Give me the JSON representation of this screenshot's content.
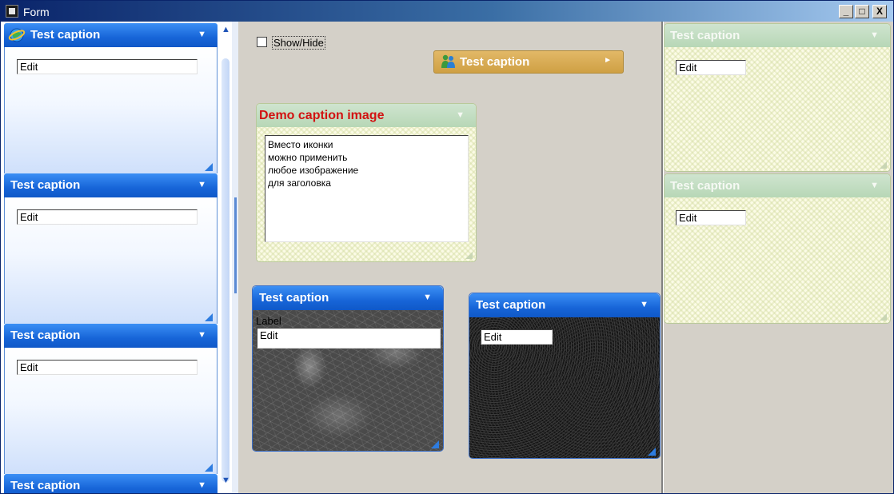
{
  "window": {
    "title": "Form",
    "min_glyph": "_",
    "max_glyph": "□",
    "close_glyph": "X"
  },
  "colors": {
    "blue_caption": "#1765d8",
    "green_caption": "#b7d7b6",
    "orange_caption": "#cfa044",
    "red_caption_text": "#d21212"
  },
  "left_accordion": {
    "panels": [
      {
        "caption": "Test caption",
        "icon": "ie-globe-icon",
        "edit_value": "Edit"
      },
      {
        "caption": "Test caption",
        "edit_value": "Edit"
      },
      {
        "caption": "Test caption",
        "edit_value": "Edit"
      },
      {
        "caption": "Test caption"
      }
    ],
    "chevron": "▼",
    "scroll_up": "▲",
    "scroll_down": "▼"
  },
  "center": {
    "show_hide_label": "Show/Hide",
    "orange_panel": {
      "caption": "Test caption",
      "icon": "people-icon",
      "chevron": "►"
    },
    "demo_panel": {
      "caption": "Demo caption image",
      "chevron": "▼",
      "memo_lines": [
        "Вместо иконки",
        "можно применить",
        "любое изображение",
        "для заголовка"
      ]
    },
    "texture_panel_1": {
      "caption": "Test caption",
      "chevron": "▼",
      "label": "Label",
      "edit_value": "Edit"
    },
    "texture_panel_2": {
      "caption": "Test caption",
      "chevron": "▼",
      "edit_value": "Edit"
    }
  },
  "right": {
    "panels": [
      {
        "caption": "Test caption",
        "chevron": "▼",
        "edit_value": "Edit"
      },
      {
        "caption": "Test caption",
        "chevron": "▼",
        "edit_value": "Edit"
      }
    ]
  }
}
